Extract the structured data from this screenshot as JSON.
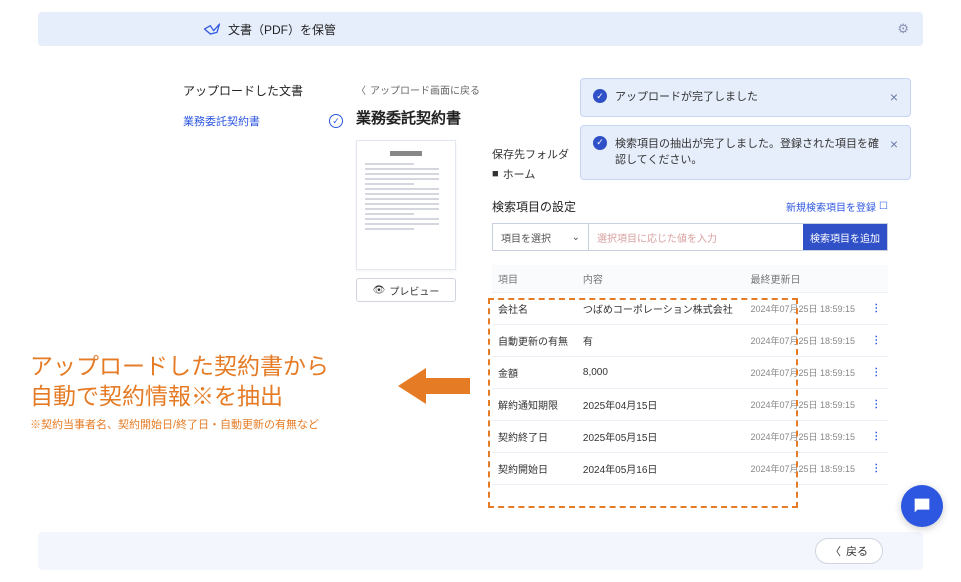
{
  "header": {
    "title": "文書（PDF）を保管"
  },
  "sidebar": {
    "heading": "アップロードした文書",
    "doc_label": "業務委託契約書"
  },
  "center": {
    "back_label": "アップロード画面に戻る",
    "doc_title": "業務委託契約書",
    "preview_label": "プレビュー"
  },
  "content": {
    "folder_label": "保存先フォルダ",
    "folder_value": "ホーム",
    "section_label": "検索項目の設定",
    "register_link": "新規検索項目を登録",
    "select_label": "項目を選択",
    "input_placeholder": "選択項目に応じた値を入力",
    "add_button": "検索項目を追加",
    "columns": {
      "name": "項目",
      "value": "内容",
      "updated": "最終更新日"
    },
    "rows": [
      {
        "name": "会社名",
        "value": "つばめコーポレーション株式会社",
        "updated": "2024年07月25日 18:59:15"
      },
      {
        "name": "自動更新の有無",
        "value": "有",
        "updated": "2024年07月25日 18:59:15"
      },
      {
        "name": "金額",
        "value": "8,000",
        "updated": "2024年07月25日 18:59:15"
      },
      {
        "name": "解約通知期限",
        "value": "2025年04月15日",
        "updated": "2024年07月25日 18:59:15"
      },
      {
        "name": "契約終了日",
        "value": "2025年05月15日",
        "updated": "2024年07月25日 18:59:15"
      },
      {
        "name": "契約開始日",
        "value": "2024年05月16日",
        "updated": "2024年07月25日 18:59:15"
      }
    ]
  },
  "toasts": [
    "アップロードが完了しました",
    "検索項目の抽出が完了しました。登録された項目を確認してください。"
  ],
  "footer": {
    "back_label": "戻る"
  },
  "caption": {
    "line1a": "アップロードした契約書から",
    "line1b": "自動で契約情報※を抽出",
    "line2": "※契約当事者名、契約開始日/終了日・自動更新の有無など"
  }
}
